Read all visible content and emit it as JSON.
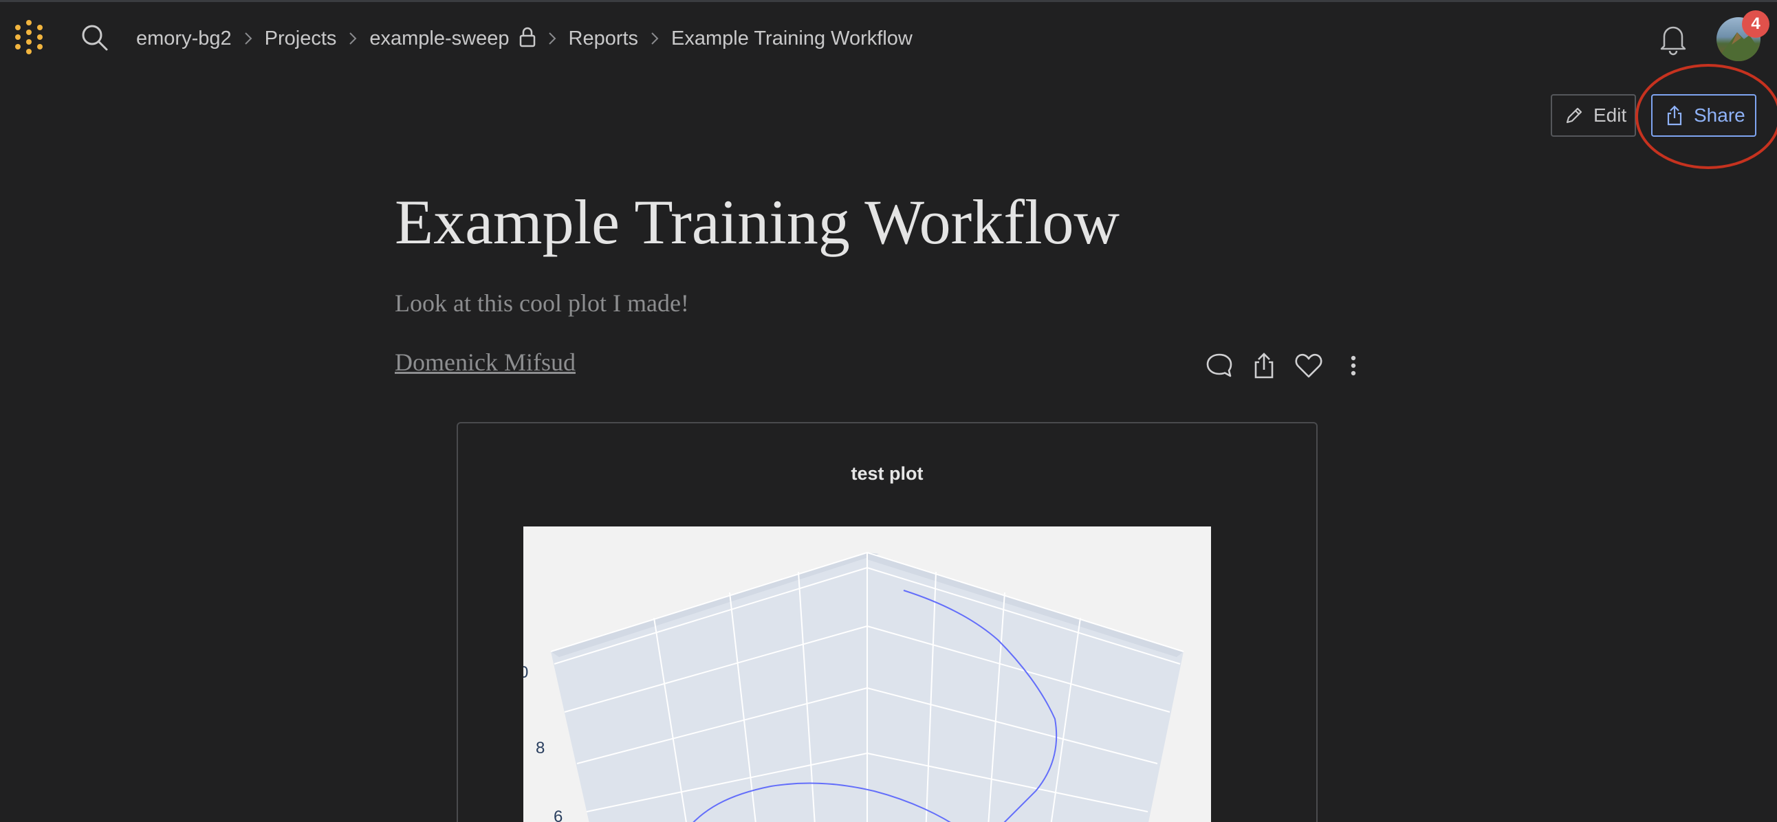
{
  "nav": {
    "breadcrumbs": [
      {
        "label": "emory-bg2"
      },
      {
        "label": "Projects"
      },
      {
        "label": "example-sweep"
      },
      {
        "label": "Reports"
      },
      {
        "label": "Example Training Workflow"
      }
    ],
    "notification_count": "4"
  },
  "toolbar": {
    "edit_label": "Edit",
    "share_label": "Share"
  },
  "report": {
    "title": "Example Training Workflow",
    "description": "Look at this cool plot I made!",
    "author": "Domenick Mifsud"
  },
  "panel": {
    "title": "test plot",
    "z_tick_labels": [
      "0",
      "8",
      "6"
    ]
  },
  "icons": {
    "logo": "dots-logo-icon",
    "search": "search-icon",
    "bell": "bell-icon",
    "lock": "lock-icon",
    "comment": "comment-icon",
    "share": "share-icon",
    "like": "heart-icon",
    "more": "more-vertical-icon",
    "edit": "pencil-icon"
  },
  "colors": {
    "logo": "#f2b53f",
    "share_accent": "#7fa5f2",
    "badge": "#e0514b",
    "annotation": "#c6321f",
    "trace": "#636efa"
  }
}
